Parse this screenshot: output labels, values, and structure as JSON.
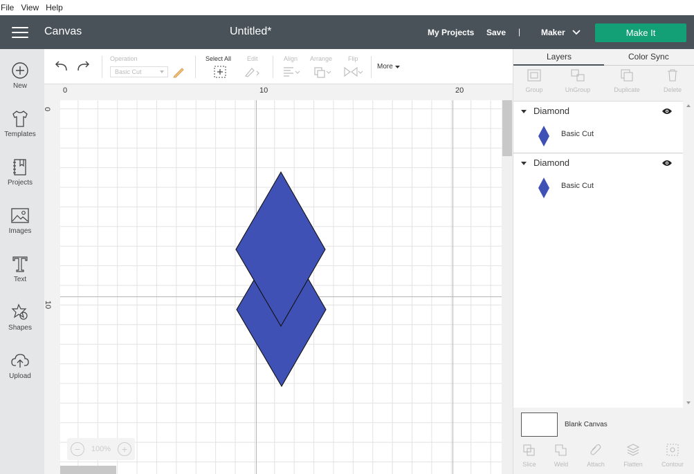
{
  "menu": {
    "file": "File",
    "view": "View",
    "help": "Help"
  },
  "header": {
    "app_title": "Canvas",
    "doc_title": "Untitled*",
    "my_projects": "My Projects",
    "save": "Save",
    "separator": "|",
    "machine": "Maker",
    "make_it": "Make It",
    "make_it_color": "#13a076",
    "bar_color": "#495159"
  },
  "sidebar": {
    "items": [
      {
        "label": "New",
        "icon": "plus-circle-icon"
      },
      {
        "label": "Templates",
        "icon": "tshirt-icon"
      },
      {
        "label": "Projects",
        "icon": "bookmark-book-icon"
      },
      {
        "label": "Images",
        "icon": "image-icon"
      },
      {
        "label": "Text",
        "icon": "text-t-icon"
      },
      {
        "label": "Shapes",
        "icon": "shapes-icon"
      },
      {
        "label": "Upload",
        "icon": "cloud-upload-icon"
      }
    ]
  },
  "toolbar": {
    "operation_label": "Operation",
    "operation_value": "Basic Cut",
    "select_all": "Select All",
    "edit": "Edit",
    "align": "Align",
    "arrange": "Arrange",
    "flip": "Flip",
    "more": "More"
  },
  "rulers": {
    "top": [
      "0",
      "10",
      "20"
    ],
    "left": [
      "0",
      "10"
    ]
  },
  "zoom": {
    "minus": "−",
    "value": "100%",
    "plus": "+"
  },
  "canvas": {
    "shape_fill": "#3f51b5",
    "shapes": [
      "Diamond",
      "Diamond"
    ]
  },
  "panel": {
    "tabs": [
      "Layers",
      "Color Sync"
    ],
    "actions": [
      "Group",
      "UnGroup",
      "Duplicate",
      "Delete"
    ],
    "layers": [
      {
        "name": "Diamond",
        "sub": "Basic Cut"
      },
      {
        "name": "Diamond",
        "sub": "Basic Cut"
      }
    ],
    "blank_canvas": "Blank Canvas",
    "bottom_actions": [
      "Slice",
      "Weld",
      "Attach",
      "Flatten",
      "Contour"
    ]
  }
}
